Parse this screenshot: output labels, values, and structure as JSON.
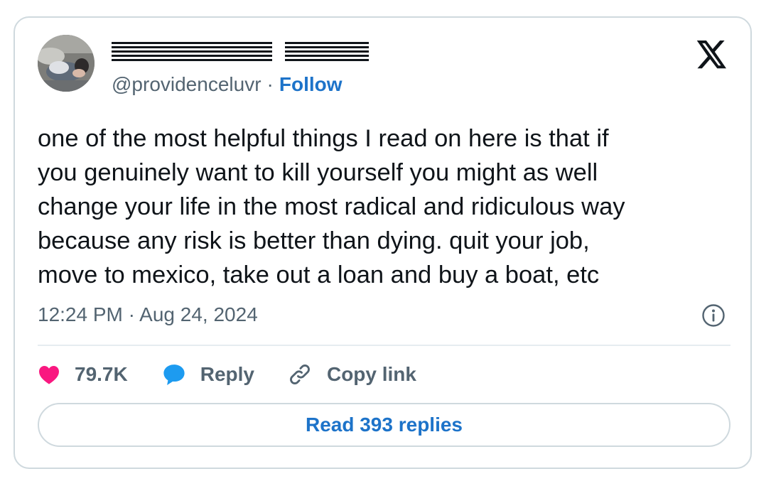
{
  "tweet": {
    "handle": "@providenceluvr",
    "separator": "·",
    "follow_label": "Follow",
    "text": "one of the most helpful things I read on here is that if\nyou genuinely want to kill yourself you might as well\nchange your life in the most radical and ridiculous way\nbecause any risk is better than dying. quit your job,\nmove to mexico, take out a loan and buy a boat, etc",
    "timestamp": "12:24 PM · Aug 24, 2024"
  },
  "actions": {
    "like_count": "79.7K",
    "reply_label": "Reply",
    "copy_link_label": "Copy link"
  },
  "read_replies_label": "Read 393 replies",
  "icons": {
    "brand": "x-logo-icon",
    "info": "info-icon",
    "like": "heart-icon",
    "reply": "speech-bubble-icon",
    "copy": "link-icon"
  },
  "colors": {
    "like": "#f91880",
    "reply": "#1d9bf0",
    "link": "#1d73c9",
    "muted": "#536471",
    "border": "#cfd9de"
  }
}
